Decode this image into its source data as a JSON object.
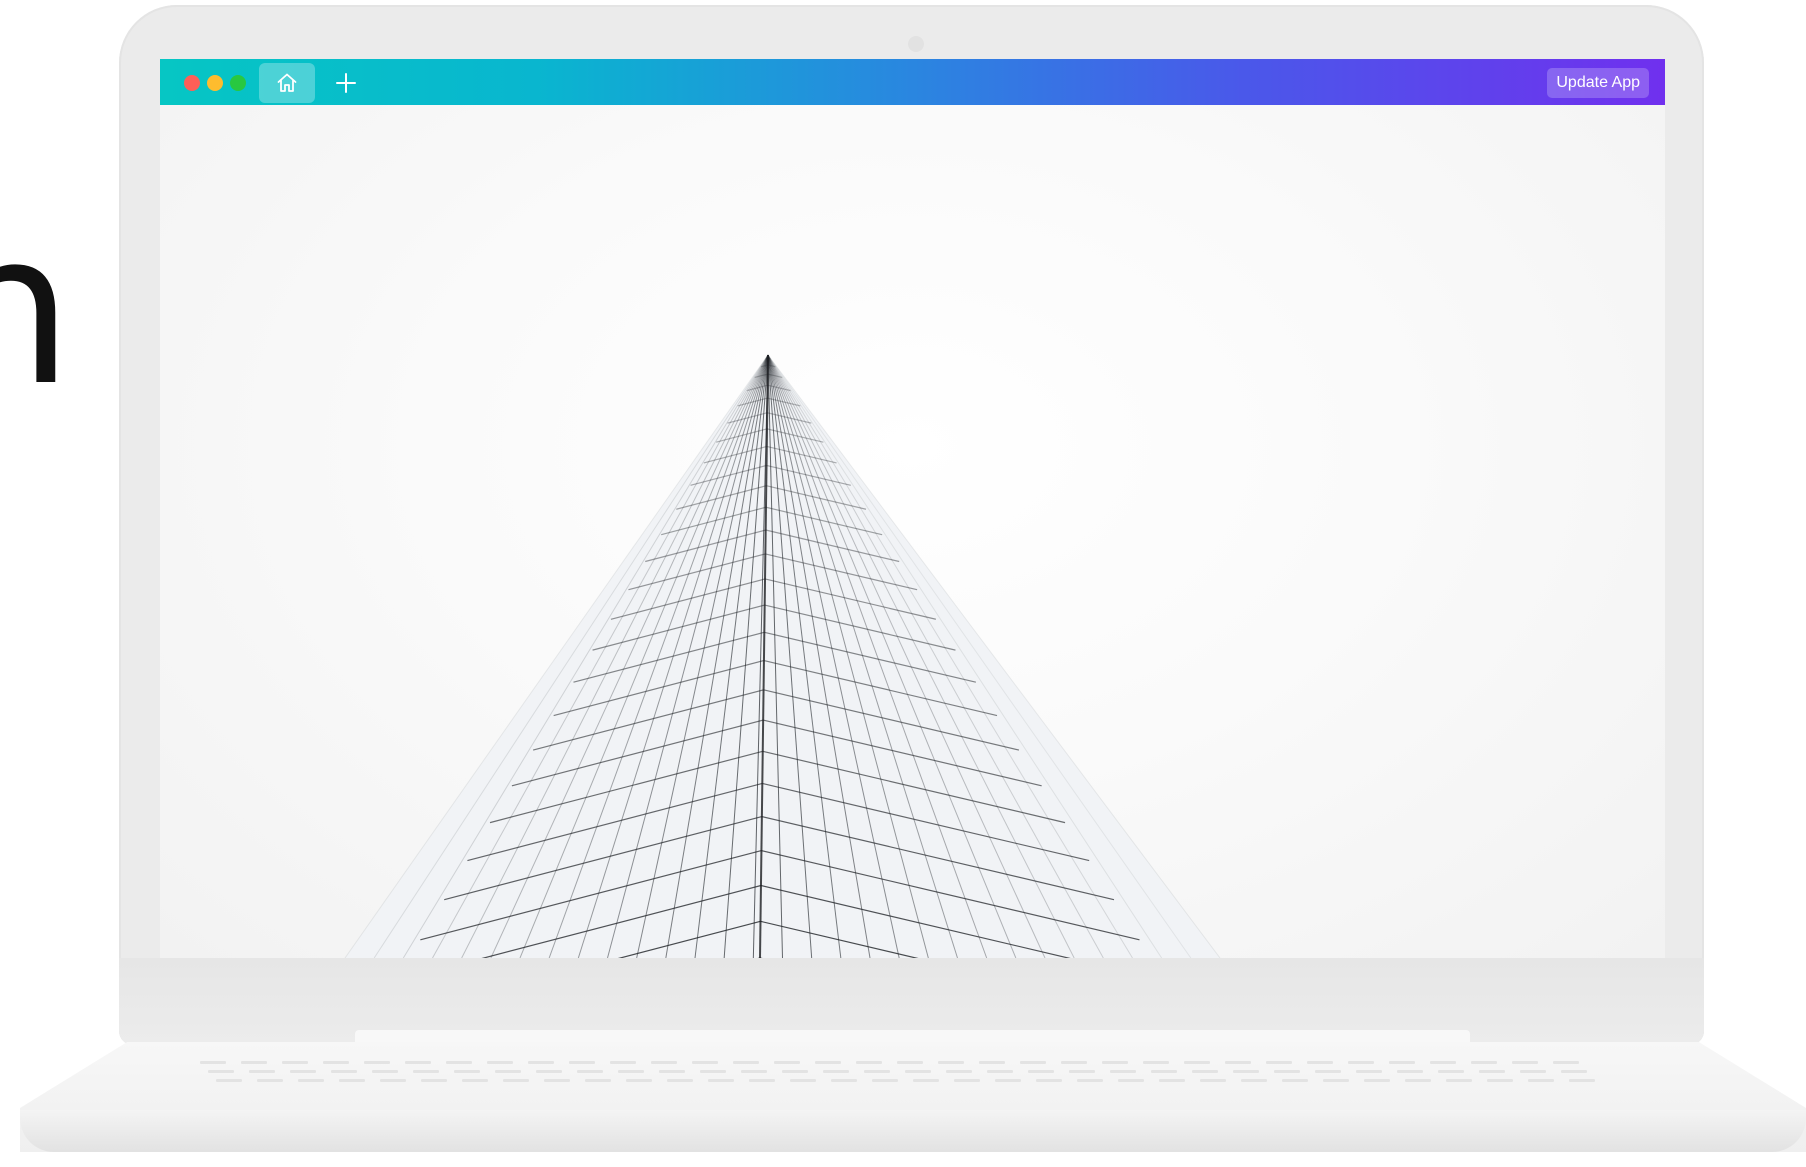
{
  "window": {
    "traffic_lights": [
      "close",
      "minimize",
      "maximize"
    ],
    "tab_icon": "home-icon",
    "new_tab_icon": "plus-icon",
    "update_button_label": "Update App"
  },
  "colors": {
    "titlebar_gradient_start": "#06c6c4",
    "titlebar_gradient_end": "#7030ee",
    "close": "#fe5f57",
    "minimize": "#febc2e",
    "maximize": "#28c840"
  },
  "content": {
    "image_subject": "glass-skyscraper-looking-up"
  }
}
